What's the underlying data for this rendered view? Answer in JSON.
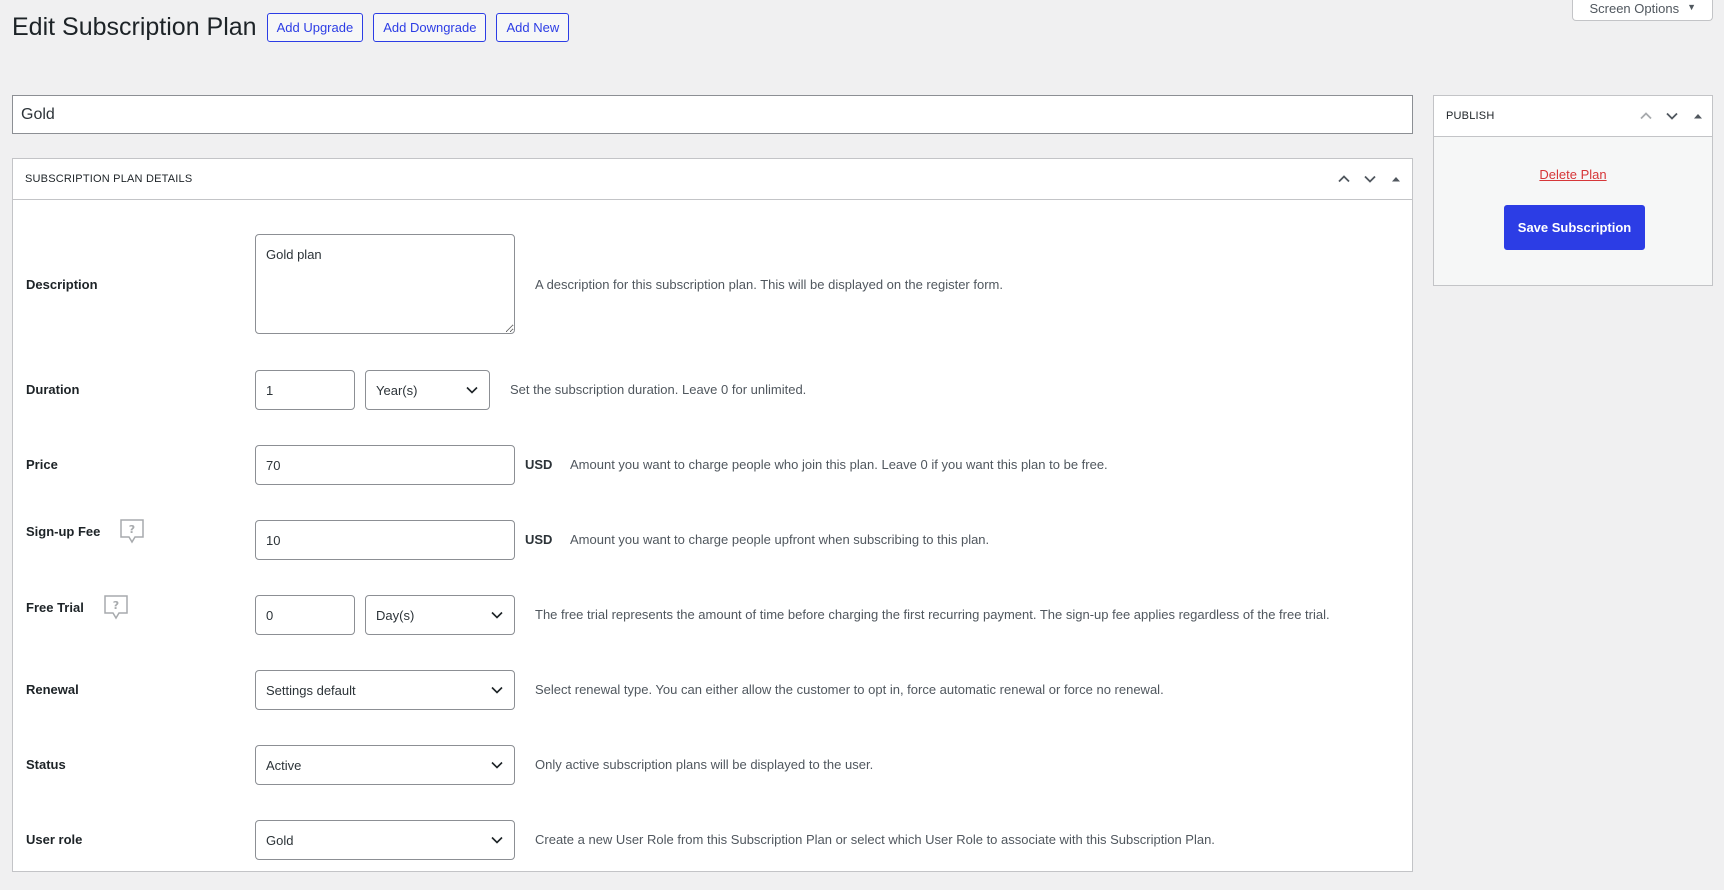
{
  "screen_options": {
    "label": "Screen Options"
  },
  "header": {
    "title": "Edit Subscription Plan",
    "actions": [
      "Add Upgrade",
      "Add Downgrade",
      "Add New"
    ]
  },
  "plan_title": {
    "value": "Gold"
  },
  "details": {
    "heading": "Subscription Plan Details",
    "fields": {
      "description": {
        "label": "Description",
        "value": "Gold plan",
        "help": "A description for this subscription plan. This will be displayed on the register form."
      },
      "duration": {
        "label": "Duration",
        "value": "1",
        "unit_selected": "Year(s)",
        "help": "Set the subscription duration. Leave 0 for unlimited."
      },
      "price": {
        "label": "Price",
        "value": "70",
        "currency": "USD",
        "help": "Amount you want to charge people who join this plan. Leave 0 if you want this plan to be free."
      },
      "signup_fee": {
        "label": "Sign-up Fee",
        "value": "10",
        "currency": "USD",
        "help": "Amount you want to charge people upfront when subscribing to this plan."
      },
      "free_trial": {
        "label": "Free Trial",
        "value": "0",
        "unit_selected": "Day(s)",
        "help": "The free trial represents the amount of time before charging the first recurring payment. The sign-up fee applies regardless of the free trial."
      },
      "renewal": {
        "label": "Renewal",
        "selected": "Settings default",
        "help": "Select renewal type. You can either allow the customer to opt in, force automatic renewal or force no renewal."
      },
      "status": {
        "label": "Status",
        "selected": "Active",
        "help": "Only active subscription plans will be displayed to the user."
      },
      "user_role": {
        "label": "User role",
        "selected": "Gold",
        "help": "Create a new User Role from this Subscription Plan or select which User Role to associate with this Subscription Plan."
      }
    }
  },
  "publish": {
    "heading": "Publish",
    "delete_label": "Delete Plan",
    "save_label": "Save Subscription"
  },
  "colors": {
    "primary": "#2c3de5",
    "danger": "#d63638",
    "background": "#f0f0f1",
    "border": "#c3c4c7"
  }
}
